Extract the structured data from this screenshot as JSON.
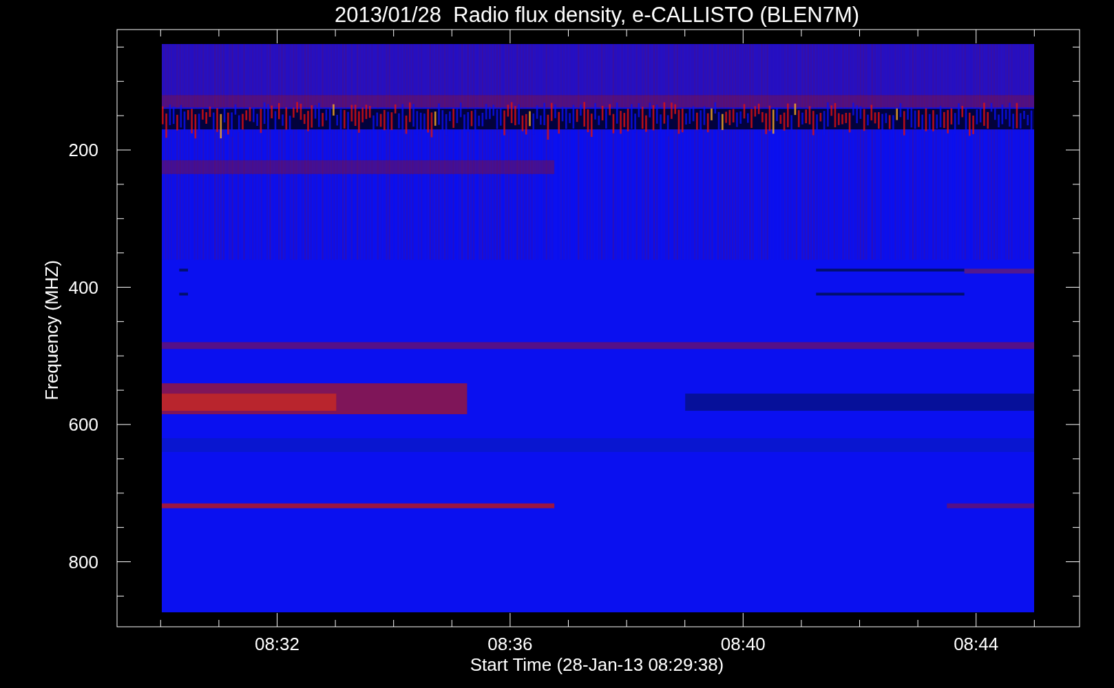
{
  "title": "2013/01/28  Radio flux density, e-CALLISTO (BLEN7M)",
  "y_axis": {
    "label": "Frequency (MHZ)",
    "ticks": [
      "200",
      "400",
      "600",
      "800"
    ]
  },
  "x_axis": {
    "label": "Start Time (28-Jan-13 08:29:38)",
    "ticks": [
      "08:32",
      "08:36",
      "08:40",
      "08:44"
    ]
  }
}
